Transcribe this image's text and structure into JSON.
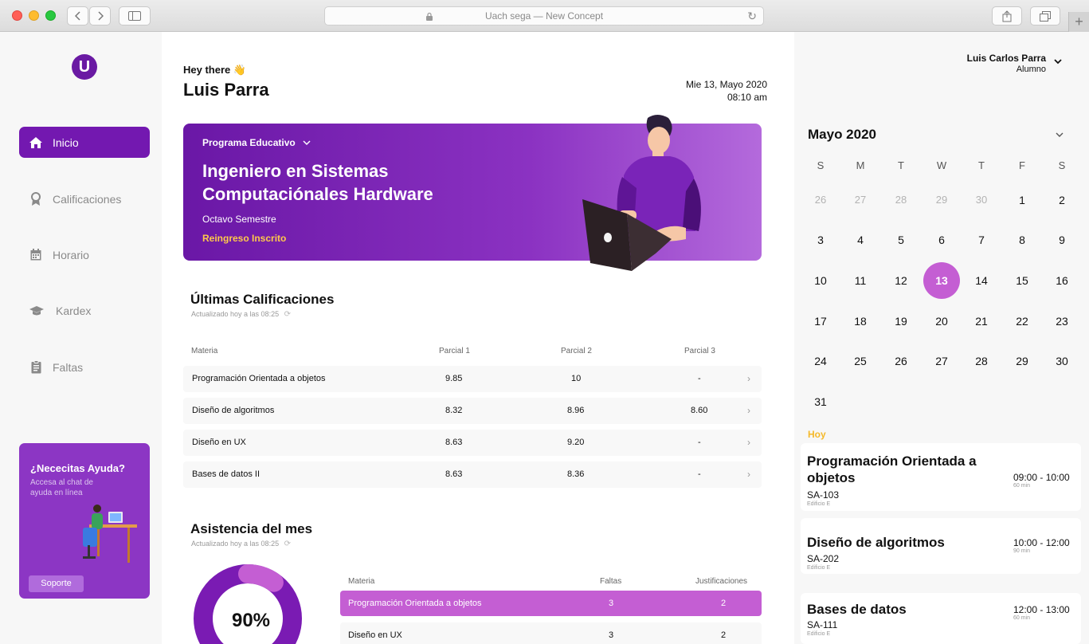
{
  "browser": {
    "url_title": "Uach sega — New Concept",
    "new_tab": "+"
  },
  "sidebar": {
    "logo": "U",
    "items": [
      {
        "label": "Inicio",
        "icon": "home-icon",
        "active": true
      },
      {
        "label": "Calificaciones",
        "icon": "award-icon",
        "active": false
      },
      {
        "label": "Horario",
        "icon": "calendar-icon",
        "active": false
      },
      {
        "label": "Kardex",
        "icon": "graduation-cap-icon",
        "active": false
      },
      {
        "label": "Faltas",
        "icon": "clipboard-icon",
        "active": false
      }
    ],
    "help": {
      "title": "¿Nececitas Ayuda?",
      "subtitle": "Accesa al chat de ayuda en línea",
      "button": "Soporte"
    }
  },
  "main": {
    "greeting": "Hey there 👋",
    "user_name": "Luis Parra",
    "date_line": "Mie 13, Mayo 2020",
    "time_line": "08:10 am",
    "banner": {
      "program_label": "Programa Educativo",
      "career": "Ingeniero en Sistemas Computaciónales Hardware",
      "semester": "Octavo Semestre",
      "status": "Reingreso Inscrito"
    },
    "grades": {
      "title": "Últimas Calificaciones",
      "updated": "Actualizado hoy a las 08:25",
      "headers": [
        "Materia",
        "Parcial 1",
        "Parcial 2",
        "Parcial 3"
      ],
      "rows": [
        {
          "subject": "Programación Orientada a objetos",
          "p1": "9.85",
          "p2": "10",
          "p3": "-"
        },
        {
          "subject": "Diseño de algoritmos",
          "p1": "8.32",
          "p2": "8.96",
          "p3": "8.60"
        },
        {
          "subject": "Diseño en UX",
          "p1": "8.63",
          "p2": "9.20",
          "p3": "-"
        },
        {
          "subject": "Bases de datos II",
          "p1": "8.63",
          "p2": "8.36",
          "p3": "-"
        }
      ]
    },
    "attendance": {
      "title": "Asistencia del mes",
      "updated": "Actualizado hoy a las 08:25",
      "percent_label": "90%",
      "percent": 90,
      "headers": [
        "Materia",
        "Faltas",
        "Justificaciones"
      ],
      "rows": [
        {
          "subject": "Programación Orientada a objetos",
          "faltas": "3",
          "justificaciones": "2",
          "highlight": true
        },
        {
          "subject": "Diseño en UX",
          "faltas": "3",
          "justificaciones": "2",
          "highlight": false
        }
      ]
    }
  },
  "right": {
    "user_name": "Luis Carlos Parra",
    "user_role": "Alumno",
    "calendar": {
      "month": "Mayo 2020",
      "weekdays": [
        "S",
        "M",
        "T",
        "W",
        "T",
        "F",
        "S"
      ],
      "prev_days": [
        "26",
        "27",
        "28",
        "29",
        "30"
      ],
      "days": [
        "1",
        "2",
        "3",
        "4",
        "5",
        "6",
        "7",
        "8",
        "9",
        "10",
        "11",
        "12",
        "13",
        "14",
        "15",
        "16",
        "17",
        "18",
        "19",
        "20",
        "21",
        "22",
        "23",
        "24",
        "25",
        "26",
        "27",
        "28",
        "29",
        "30",
        "31"
      ],
      "today": "13"
    },
    "today_label": "Hoy",
    "classes": [
      {
        "name": "Programación Orientada a objetos",
        "room": "SA-103",
        "building": "Edificio E",
        "time": "09:00 - 10:00",
        "duration": "60 min"
      },
      {
        "name": "Diseño de algoritmos",
        "room": "SA-202",
        "building": "Edificio E",
        "time": "10:00 - 12:00",
        "duration": "90 min"
      },
      {
        "name": "Bases de datos",
        "room": "SA-111",
        "building": "Edificio E",
        "time": "12:00 - 13:00",
        "duration": "60 min"
      }
    ]
  },
  "colors": {
    "primary": "#7318b0",
    "accent": "#c45ed3",
    "highlight_text": "#ffc94a",
    "today_label": "#f5b92a"
  }
}
